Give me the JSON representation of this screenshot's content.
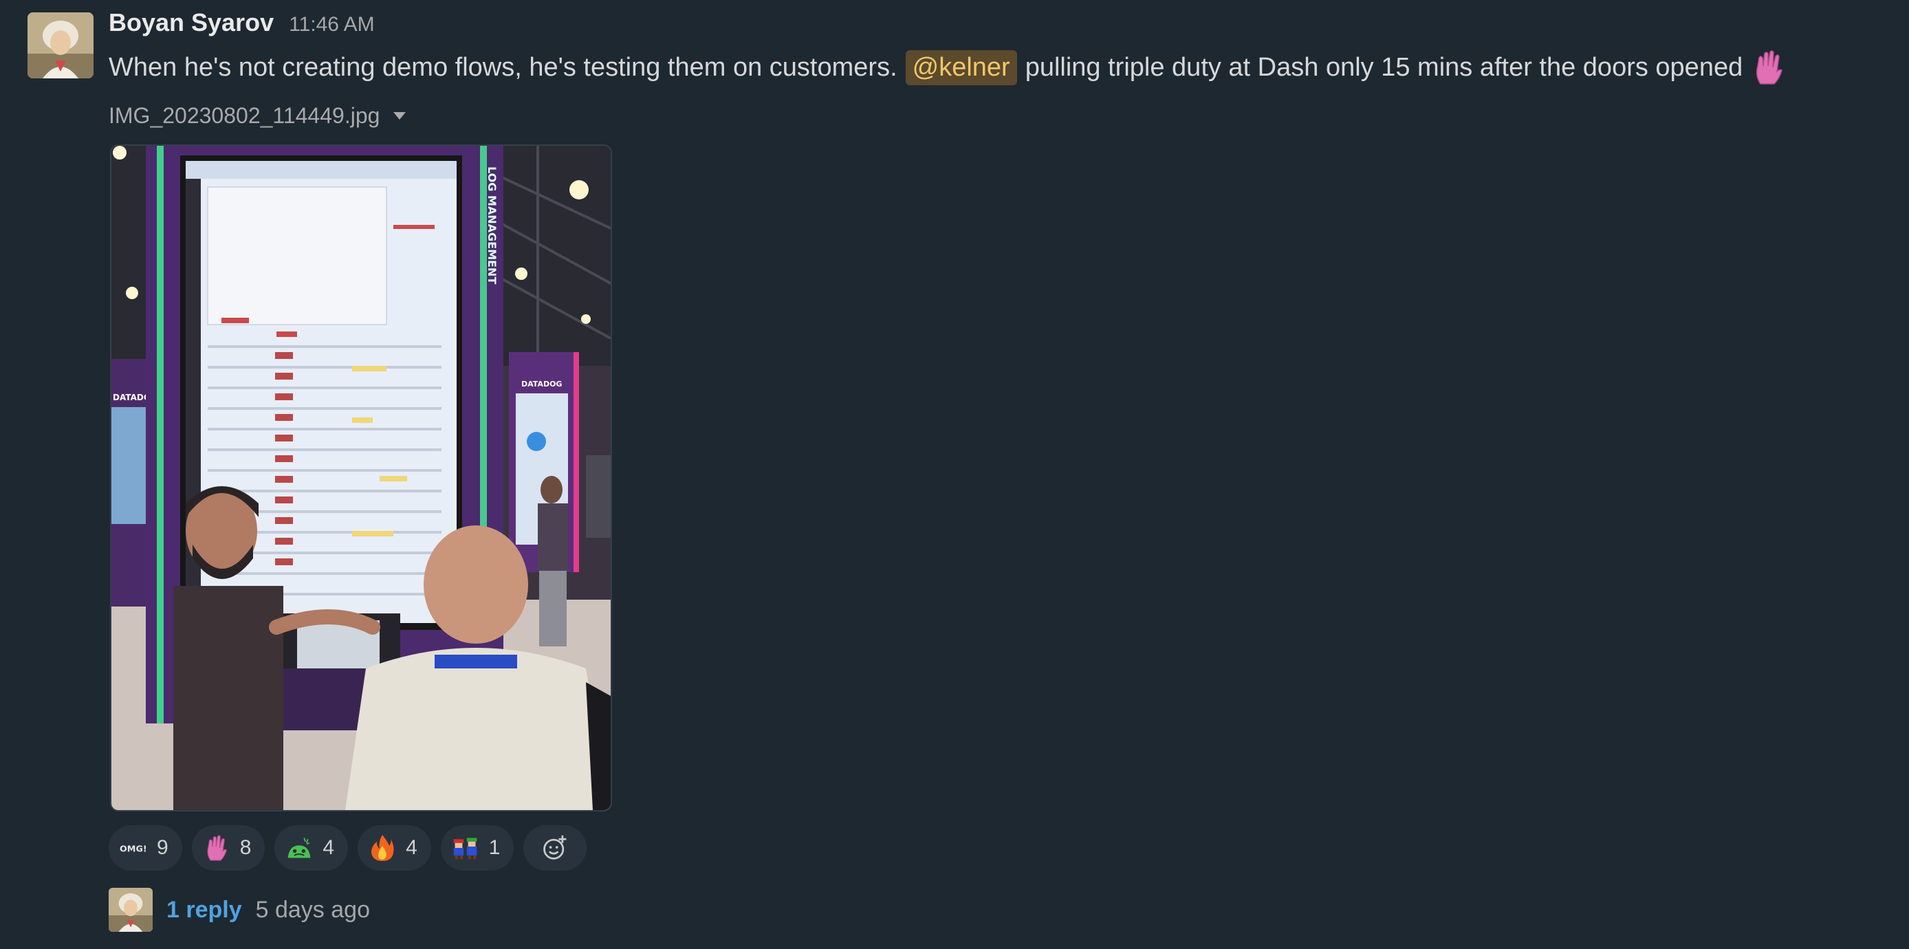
{
  "message": {
    "author": "Boyan Syarov",
    "timestamp": "11:46 AM",
    "text_before": "When he's not creating demo flows, he's testing them on customers.",
    "mention": "@kelner",
    "text_after": "pulling triple duty at Dash only 15 mins after the doors opened",
    "trailing_emoji": "raised-hand-icon"
  },
  "attachment": {
    "filename": "IMG_20230802_114449.jpg",
    "image_logo_text": "DATADOG",
    "image_side_text": "LOG MANAGEMENT"
  },
  "reactions": [
    {
      "emoji": "omg-icon",
      "label": "OMG!",
      "count": "9"
    },
    {
      "emoji": "raised-hand-icon",
      "count": "8"
    },
    {
      "emoji": "frog-icon",
      "count": "4"
    },
    {
      "emoji": "fire-icon",
      "count": "4"
    },
    {
      "emoji": "mario-luigi-icon",
      "count": "1"
    }
  ],
  "thread": {
    "reply_label": "1 reply",
    "time": "5 days ago"
  },
  "colors": {
    "background": "#1e2831",
    "mention_bg": "#5b4a2b",
    "mention_text": "#f1c76b",
    "link": "#4fa3e0"
  }
}
